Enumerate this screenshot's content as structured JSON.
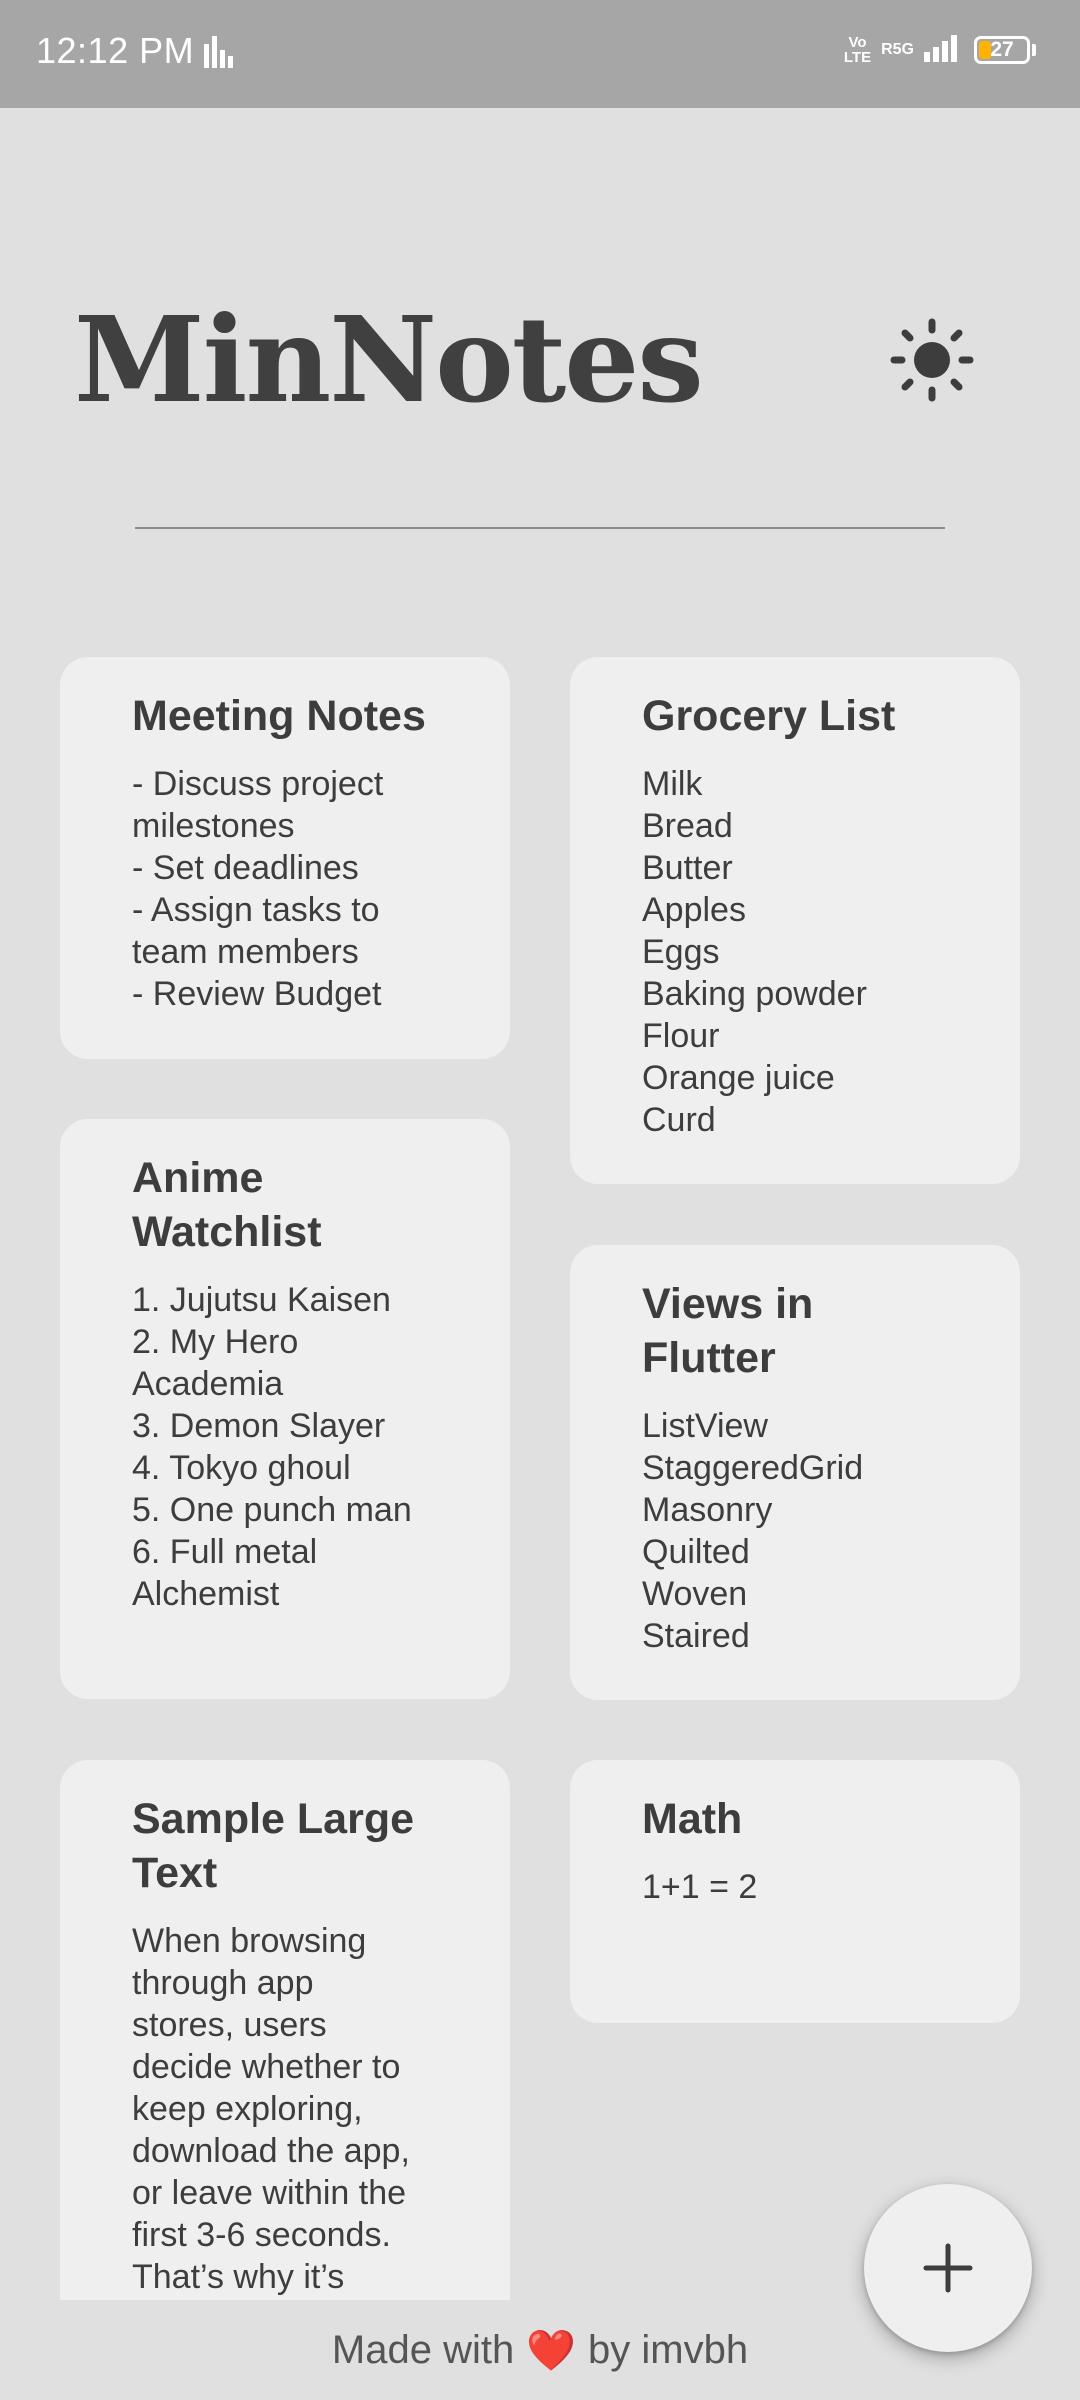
{
  "status_bar": {
    "time": "12:12 PM",
    "network_volte": "Vo\nLTE",
    "network_type": "R5G",
    "battery": "27",
    "battery_level": 0.27
  },
  "header": {
    "title": "MinNotes",
    "theme_icon": "sun-icon"
  },
  "notes": [
    {
      "title": "Meeting Notes",
      "body": "- Discuss project\nmilestones\n- Set deadlines\n- Assign tasks to\nteam members\n- Review Budget"
    },
    {
      "title": "Grocery List",
      "body": "Milk\nBread\nButter\nApples\nEggs\nBaking powder\nFlour\nOrange juice\nCurd"
    },
    {
      "title": "Anime\nWatchlist",
      "body": "1. Jujutsu Kaisen\n2. My Hero\nAcademia\n3. Demon Slayer\n4. Tokyo ghoul\n5. One punch man\n6. Full metal\nAlchemist"
    },
    {
      "title": "Views in\nFlutter",
      "body": "ListView\nStaggeredGrid\nMasonry\nQuilted\nWoven\nStaired"
    },
    {
      "title": "Sample Large\nText",
      "body": "When browsing\nthrough app\nstores, users\ndecide whether to\nkeep exploring,\ndownload the app,\nor leave within the\nfirst 3-6 seconds.\nThat’s why it’s"
    },
    {
      "title": "Math",
      "body": "1+1 = 2"
    }
  ],
  "fab": {
    "icon": "plus-icon"
  },
  "footer": {
    "prefix": "Made with",
    "heart": "❤️",
    "suffix": "by imvbh"
  }
}
